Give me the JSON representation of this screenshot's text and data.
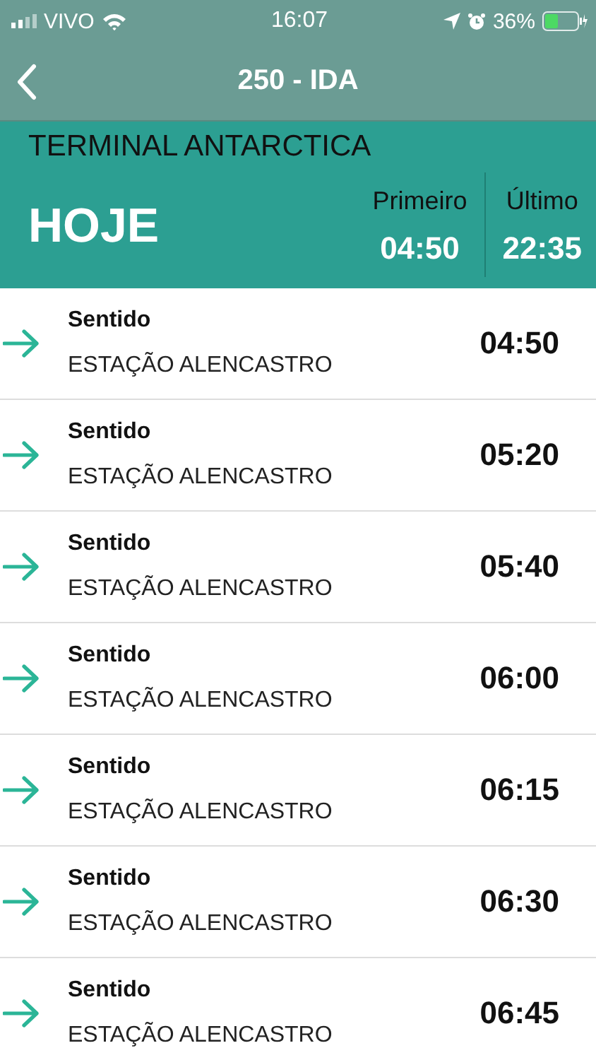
{
  "status_bar": {
    "carrier": "VIVO",
    "time": "16:07",
    "battery": "36%"
  },
  "nav": {
    "title": "250 - IDA"
  },
  "header": {
    "stop": "TERMINAL ANTARCTICA",
    "day": "HOJE",
    "first_label": "Primeiro",
    "first_time": "04:50",
    "last_label": "Último",
    "last_time": "22:35"
  },
  "departures": [
    {
      "label": "Sentido",
      "destination": "ESTAÇÃO ALENCASTRO",
      "time": "04:50"
    },
    {
      "label": "Sentido",
      "destination": "ESTAÇÃO ALENCASTRO",
      "time": "05:20"
    },
    {
      "label": "Sentido",
      "destination": "ESTAÇÃO ALENCASTRO",
      "time": "05:40"
    },
    {
      "label": "Sentido",
      "destination": "ESTAÇÃO ALENCASTRO",
      "time": "06:00"
    },
    {
      "label": "Sentido",
      "destination": "ESTAÇÃO ALENCASTRO",
      "time": "06:15"
    },
    {
      "label": "Sentido",
      "destination": "ESTAÇÃO ALENCASTRO",
      "time": "06:30"
    },
    {
      "label": "Sentido",
      "destination": "ESTAÇÃO ALENCASTRO",
      "time": "06:45"
    }
  ]
}
